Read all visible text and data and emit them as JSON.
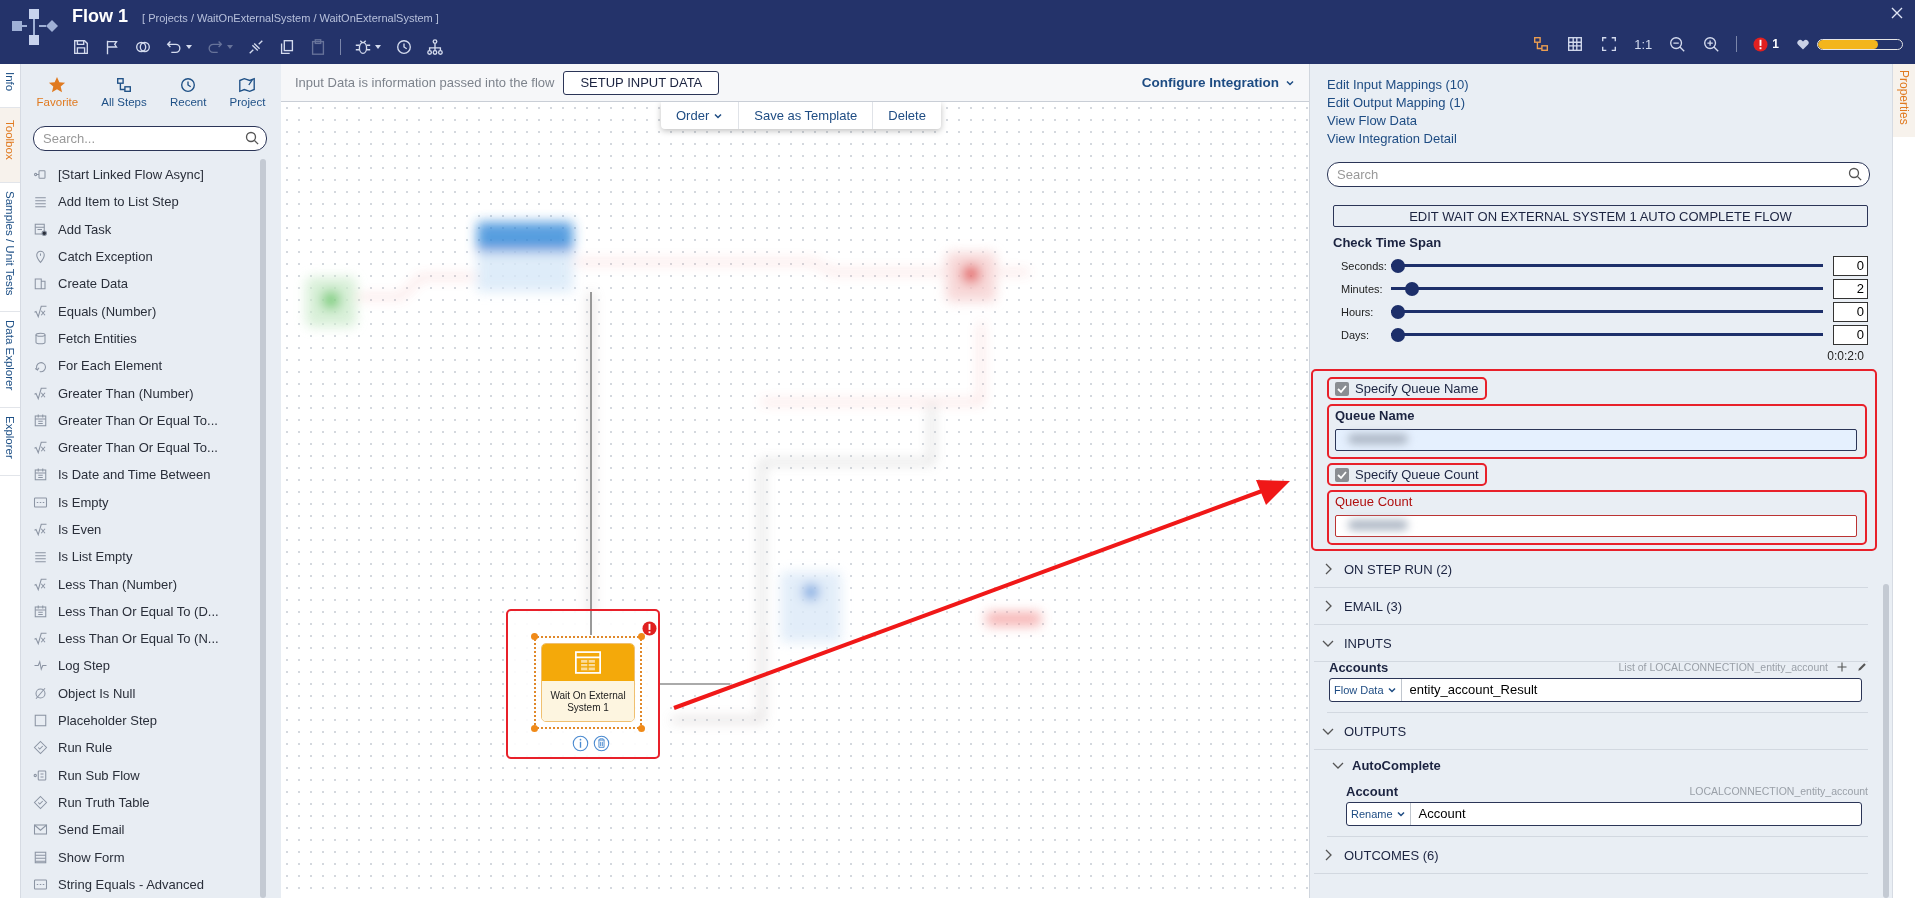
{
  "app": {
    "title": "Flow 1",
    "breadcrumb": "[ Projects / WaitOnExternalSystem / WaitOnExternalSystem ]",
    "tools": [
      {
        "kind": "save",
        "disabled": false,
        "dropdown": false
      },
      {
        "kind": "flag",
        "disabled": false,
        "dropdown": false
      },
      {
        "kind": "layers",
        "disabled": false,
        "dropdown": false
      },
      {
        "kind": "undo",
        "disabled": false,
        "dropdown": true
      },
      {
        "kind": "redo",
        "disabled": true,
        "dropdown": true
      },
      {
        "kind": "connect",
        "disabled": false,
        "dropdown": false
      },
      {
        "kind": "copy",
        "disabled": false,
        "dropdown": false
      },
      {
        "kind": "paste",
        "disabled": true,
        "dropdown": false
      },
      {
        "kind": "debug",
        "disabled": false,
        "dropdown": true
      },
      {
        "kind": "history",
        "disabled": false,
        "dropdown": false
      },
      {
        "kind": "hierarchy",
        "disabled": false,
        "dropdown": false
      }
    ],
    "view_tools": [
      {
        "kind": "steps"
      },
      {
        "kind": "grid"
      },
      {
        "kind": "fullscreen"
      },
      {
        "kind": "text",
        "label": "1:1"
      },
      {
        "kind": "zoom-out"
      },
      {
        "kind": "zoom-in"
      }
    ],
    "error_count": "1",
    "health": {
      "level": 0.72
    }
  },
  "left_tabs": [
    {
      "label": "Info",
      "selected": false
    },
    {
      "label": "Toolbox",
      "selected": true
    },
    {
      "label": "Samples / Unit Tests",
      "selected": false
    },
    {
      "label": "Data Explorer",
      "selected": false
    },
    {
      "label": "Explorer",
      "selected": false
    }
  ],
  "toolbox": {
    "tabs": [
      {
        "label": "Favorite",
        "kind": "star",
        "selected": true
      },
      {
        "label": "All Steps",
        "kind": "steps",
        "selected": false
      },
      {
        "label": "Recent",
        "kind": "history",
        "selected": false
      },
      {
        "label": "Project",
        "kind": "map",
        "selected": false
      }
    ],
    "search_placeholder": "Search...",
    "items": [
      {
        "label": "[Start Linked Flow Async]",
        "kind": "nodes"
      },
      {
        "label": "Add Item to List Step",
        "kind": "lines"
      },
      {
        "label": "Add Task",
        "kind": "task"
      },
      {
        "label": "Catch Exception",
        "kind": "pin"
      },
      {
        "label": "Create Data",
        "kind": "pages"
      },
      {
        "label": "Equals (Number)",
        "kind": "sqrt"
      },
      {
        "label": "Fetch Entities",
        "kind": "cylinder"
      },
      {
        "label": "For Each Element",
        "kind": "loop"
      },
      {
        "label": "Greater Than (Number)",
        "kind": "sqrt"
      },
      {
        "label": "Greater Than Or Equal To...",
        "kind": "calendar"
      },
      {
        "label": "Greater Than Or Equal To...",
        "kind": "sqrt"
      },
      {
        "label": "Is Date and Time Between",
        "kind": "calendar"
      },
      {
        "label": "Is Empty",
        "kind": "dashes"
      },
      {
        "label": "Is Even",
        "kind": "sqrt"
      },
      {
        "label": "Is List Empty",
        "kind": "lines"
      },
      {
        "label": "Less Than (Number)",
        "kind": "sqrt"
      },
      {
        "label": "Less Than Or Equal To (D...",
        "kind": "calendar"
      },
      {
        "label": "Less Than Or Equal To (N...",
        "kind": "sqrt"
      },
      {
        "label": "Log Step",
        "kind": "pulse"
      },
      {
        "label": "Object Is Null",
        "kind": "empty-set"
      },
      {
        "label": "Placeholder Step",
        "kind": "square"
      },
      {
        "label": "Run Rule",
        "kind": "check-diamond"
      },
      {
        "label": "Run Sub Flow",
        "kind": "subflow"
      },
      {
        "label": "Run Truth Table",
        "kind": "check-diamond"
      },
      {
        "label": "Send Email",
        "kind": "envelope"
      },
      {
        "label": "Show Form",
        "kind": "form"
      },
      {
        "label": "String Equals - Advanced",
        "kind": "dashes"
      }
    ]
  },
  "canvas": {
    "hint": "Input Data is information passed into the flow",
    "setup_button": "SETUP INPUT DATA",
    "configure": "Configure Integration",
    "actions": [
      {
        "label": "Order",
        "dropdown": true
      },
      {
        "label": "Save as Template",
        "dropdown": false
      },
      {
        "label": "Delete",
        "dropdown": false
      }
    ],
    "step": {
      "label": "Wait On External System 1",
      "error": true,
      "selected": true,
      "highlighted": true
    },
    "show_arrow": true
  },
  "properties": {
    "tab": "Properties",
    "links": [
      "Edit Input Mappings (10)",
      "Edit Output Mapping (1)",
      "View Flow Data",
      "View Integration Detail"
    ],
    "search_placeholder": "Search",
    "edit_button": "EDIT WAIT ON EXTERNAL SYSTEM 1 AUTO COMPLETE FLOW",
    "time_span": {
      "title": "Check Time Span",
      "rows": [
        {
          "label": "Seconds:",
          "value": "0",
          "level": 0
        },
        {
          "label": "Minutes:",
          "value": "2",
          "level": 0.033
        },
        {
          "label": "Hours:",
          "value": "0",
          "level": 0
        },
        {
          "label": "Days:",
          "value": "0",
          "level": 0
        }
      ],
      "total": "0:0:2:0"
    },
    "queue": {
      "highlighted": true,
      "items": [
        {
          "kind": "checkbox",
          "label": "Specify Queue Name",
          "checked": true,
          "highlighted": true
        },
        {
          "kind": "field",
          "label": "Queue Name",
          "error": false,
          "highlighted": true
        },
        {
          "kind": "checkbox",
          "label": "Specify Queue Count",
          "checked": true,
          "highlighted": true
        },
        {
          "kind": "field",
          "label": "Queue Count",
          "error": true,
          "highlighted": true
        }
      ]
    },
    "sections": [
      {
        "title": "ON STEP RUN (2)",
        "expanded": false
      },
      {
        "title": "EMAIL (3)",
        "expanded": false
      },
      {
        "title": "INPUTS",
        "expanded": true,
        "fields": [
          {
            "label": "Accounts",
            "type": "List of LOCALCONNECTION_entity_account",
            "mode": "Flow Data",
            "value": "entity_account_Result",
            "editable": true
          }
        ]
      },
      {
        "title": "OUTPUTS",
        "expanded": true,
        "groups": [
          {
            "title": "AutoComplete",
            "expanded": true,
            "fields": [
              {
                "label": "Account",
                "type": "LOCALCONNECTION_entity_account",
                "mode": "Rename",
                "value": "Account"
              }
            ]
          }
        ]
      },
      {
        "title": "OUTCOMES (6)",
        "expanded": false
      }
    ]
  }
}
